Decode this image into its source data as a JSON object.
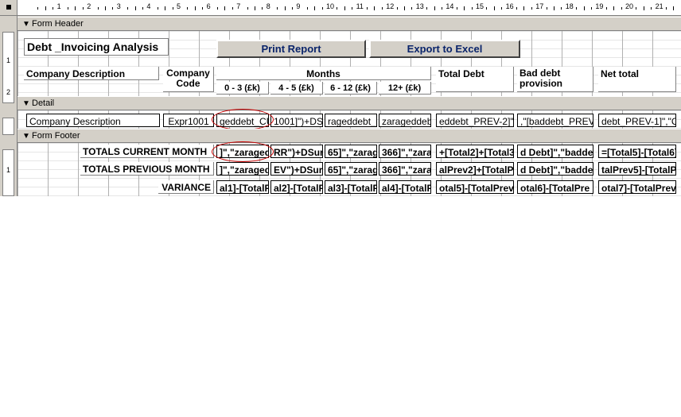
{
  "ruler": {
    "numbers": [
      "1",
      "2",
      "3",
      "4",
      "5",
      "6",
      "7",
      "8",
      "9",
      "10",
      "11",
      "12",
      "13",
      "14",
      "15",
      "16",
      "17",
      "18",
      "19",
      "20",
      "21"
    ]
  },
  "vruler": {
    "header_labels": [
      "1",
      "2"
    ],
    "footer_labels": [
      "1"
    ]
  },
  "sections": {
    "form_header": "Form Header",
    "detail": "Detail",
    "form_footer": "Form Footer"
  },
  "header": {
    "title": "Debt _Invoicing Analysis",
    "print_button": "Print Report",
    "export_button": "Export to Excel",
    "company_description": "Company Description",
    "company_code": "Company Code",
    "months": "Months",
    "m0_3": "0 - 3 (£k)",
    "m4_5": "4 - 5  (£k)",
    "m6_12": "6 - 12  (£k)",
    "m12p": "12+  (£k)",
    "total_debt": "Total Debt",
    "bad_debt": "Bad debt provision",
    "net_total": "Net total"
  },
  "detail": {
    "company_description": "Company Description",
    "expr": "Expr1001",
    "c1": "geddebt_CUI",
    "c2": "1001]\")+DSu",
    "c3": "rageddebt_C",
    "c4": "zarageddebt_",
    "c5": "eddebt_PREV-2]\",\"C",
    "c6": ",\"[baddebt_PREV-1",
    "c7": "debt_PREV-1]\",\"CoC"
  },
  "footer": {
    "current_label": "TOTALS CURRENT MONTH",
    "previous_label": "TOTALS PREVIOUS MONTH",
    "variance_label": "VARIANCE",
    "current": [
      "]\",\"zaraged",
      "RR\")+DSur",
      "65]\",\"zarag",
      "366]\",\"zara",
      "+[Total2]+[Total3",
      "d Debt]\",\"badde",
      "=[Total5]-[Total6]"
    ],
    "previous": [
      "]\",\"zaraged",
      "EV\")+DSur",
      "65]\",\"zarag",
      "366]\",\"zara",
      "alPrev2]+[TotalP",
      "d Debt]\",\"badde",
      "talPrev5]-[TotalPr"
    ],
    "variance": [
      "al1]-[TotalF",
      "al2]-[TotalF",
      "al3]-[TotalF",
      "al4]-[TotalF",
      "otal5]-[TotalPrev",
      "otal6]-[TotalPre",
      "otal7]-[TotalPrev"
    ]
  },
  "colors": {
    "background": "#d4d0c8",
    "button_text": "#0a246a",
    "annotation": "#c80000"
  }
}
